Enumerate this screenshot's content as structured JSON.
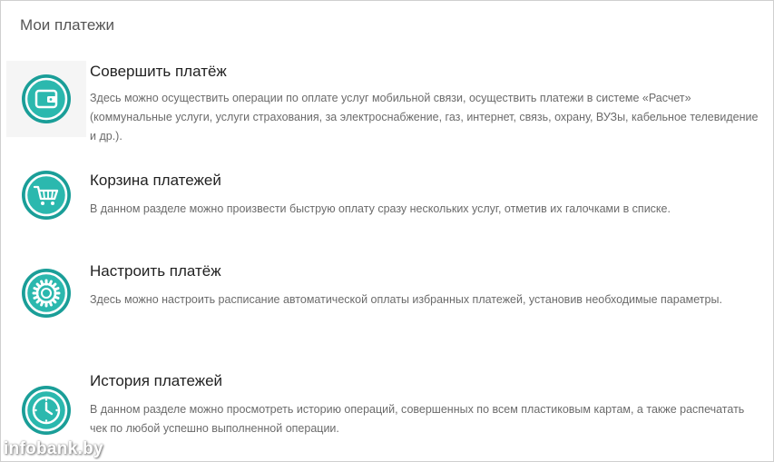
{
  "page": {
    "title": "Мои платежи"
  },
  "items": [
    {
      "title": "Совершить платёж",
      "description": "Здесь можно осуществить операции по оплате услуг мобильной связи, осуществить платежи в системе «Расчет» (коммунальные услуги, услуги страхования, за электроснабжение, газ, интернет, связь, охрану, ВУЗы, кабельное телевидение и др.).",
      "icon": "wallet-icon"
    },
    {
      "title": "Корзина платежей",
      "description": "В данном разделе можно произвести быструю оплату сразу нескольких услуг, отметив их галочками в списке.",
      "icon": "cart-icon"
    },
    {
      "title": "Настроить платёж",
      "description": "Здесь можно настроить расписание автоматической оплаты избранных платежей, установив необходимые параметры.",
      "icon": "gear-icon"
    },
    {
      "title": "История платежей",
      "description": "В данном разделе можно просмотреть историю операций, совершенных по всем пластиковым картам, а также распечатать чек по любой успешно выполненной операции.",
      "icon": "clock-icon"
    }
  ],
  "watermark": "infobank.by",
  "colors": {
    "icon_outer": "#1a9e98",
    "icon_inner": "#2bb8ae",
    "icon_ring": "#ffffff"
  }
}
